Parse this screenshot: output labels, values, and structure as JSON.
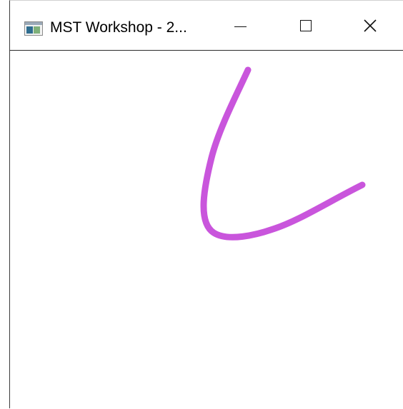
{
  "window": {
    "title": "MST Workshop - 2...",
    "app_icon": "application-window-icon"
  },
  "title_buttons": {
    "minimize_icon": "minimize-icon",
    "maximize_icon": "maximize-icon",
    "close_icon": "close-icon"
  },
  "canvas": {
    "background_color": "#ffffff",
    "stroke_color": "#c955dc"
  }
}
